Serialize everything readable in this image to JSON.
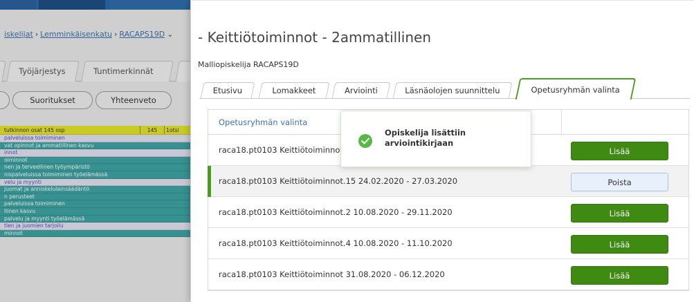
{
  "background": {
    "breadcrumb": [
      "iskelijat",
      "Lemminkäisenkatu",
      "RACAPS19D"
    ],
    "tabs": [
      "Työjärjestys",
      "Tuntimerkinnät"
    ],
    "pills": [
      "Suoritukset",
      "Yhteenveto"
    ],
    "summary_row": {
      "label": "tutkinnon osat 145 osp",
      "num": "145",
      "tag": "1otsi"
    },
    "rows": [
      "palveluissa toimiminen",
      "vat opinnot ja ammatillinen kasvu",
      "innot",
      "oiminnot",
      "nen ja terveellinen työympäristö",
      "nispalveluissa toimiminen työelämässä",
      "velu ja myynti",
      "juomat ja anniskelulainsäädäntö",
      "n perusteet",
      "palveluissa toimiminen",
      "llinen kasvu",
      "palvelu ja myynti työelämässä",
      "tien ja juomien tarjoilu",
      "minnot"
    ]
  },
  "dialog": {
    "title": "- Keittiötoiminnot - 2ammatillinen",
    "subtitle": "Malliopiskelija RACAPS19D",
    "tabs": [
      "Etusivu",
      "Lomakkeet",
      "Arviointi",
      "Läsnäolojen suunnittelu",
      "Opetusryhmän valinta"
    ],
    "active_tab": "Opetusryhmän valinta",
    "table": {
      "header": "Opetusryhmän valinta",
      "rows": [
        {
          "name": "raca18.pt0103 Keittiötoiminnot",
          "action": "Lisää"
        },
        {
          "name": "raca18.pt0103 Keittiötoiminnot.15 24.02.2020 - 27.03.2020",
          "action": "Poista"
        },
        {
          "name": "raca18.pt0103 Keittiötoiminnot.2 10.08.2020 - 29.11.2020",
          "action": "Lisää"
        },
        {
          "name": "raca18.pt0103 Keittiötoiminnot.4 10.08.2020 - 11.10.2020",
          "action": "Lisää"
        },
        {
          "name": "raca18.pt0103 Keittiötoiminnot 31.08.2020 - 06.12.2020",
          "action": "Lisää"
        }
      ]
    },
    "toast": {
      "message": "Opiskelija lisättiin arviointikirjaan",
      "icon": "check-circle-icon"
    }
  },
  "colors": {
    "accent_green": "#4b9b1e",
    "add_button": "#3f8a12",
    "link_blue": "#3c74b0",
    "success_icon": "#58b845"
  }
}
